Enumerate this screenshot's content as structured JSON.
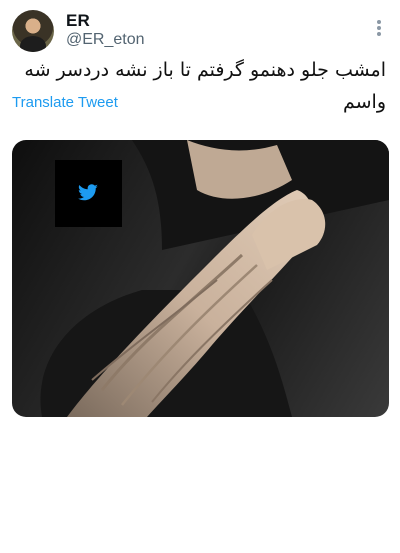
{
  "tweet": {
    "display_name": "ER",
    "handle": "@ER_eton",
    "text": "امشب جلو دهنمو گرفتم تا باز نشه دردسر شه واسم",
    "translate_label": "Translate Tweet"
  },
  "icons": {
    "more": "more-options-icon",
    "watermark": "twitter-bird-icon"
  },
  "colors": {
    "link": "#1d9bf0",
    "handle": "#536471"
  }
}
